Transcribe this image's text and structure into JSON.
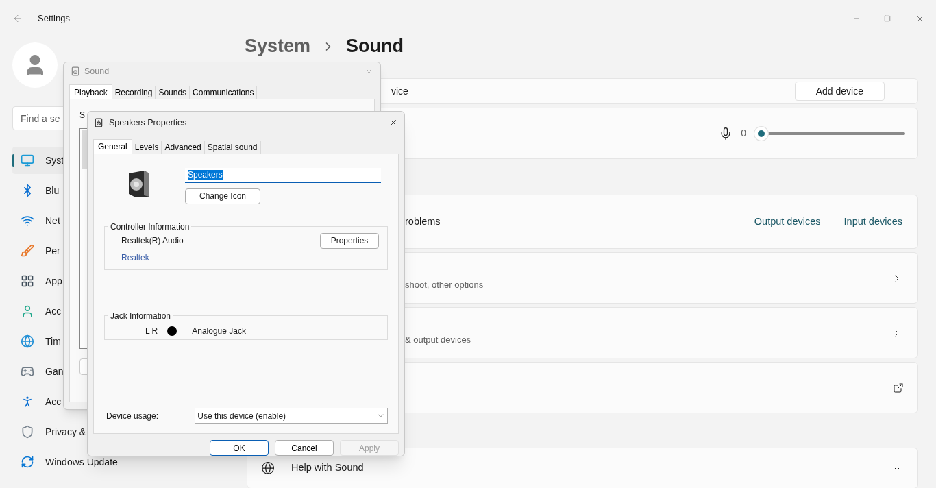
{
  "window": {
    "title": "Settings"
  },
  "search": {
    "placeholder": "Find a se"
  },
  "sidebar": {
    "items": [
      {
        "label": "Syst",
        "selected": true
      },
      {
        "label": "Blu",
        "selected": false
      },
      {
        "label": "Net",
        "selected": false
      },
      {
        "label": "Per",
        "selected": false
      },
      {
        "label": "App",
        "selected": false
      },
      {
        "label": "Acc",
        "selected": false
      },
      {
        "label": "Tim",
        "selected": false
      },
      {
        "label": "Gan",
        "selected": false
      },
      {
        "label": "Acc",
        "selected": false
      },
      {
        "label": "Privacy &",
        "selected": false
      },
      {
        "label": "Windows Update",
        "selected": false
      }
    ]
  },
  "breadcrumb": {
    "parent": "System",
    "current": "Sound"
  },
  "cards": [
    {
      "kind": "button",
      "text": "vice",
      "button": "Add device"
    },
    {
      "kind": "volume",
      "reading": "0",
      "level": 0
    },
    {
      "kind": "links",
      "text": "roblems",
      "links": [
        "Output devices",
        "Input devices"
      ]
    },
    {
      "kind": "nav",
      "subtitle": "shoot, other options"
    },
    {
      "kind": "nav",
      "subtitle": "& output devices"
    },
    {
      "kind": "external"
    }
  ],
  "help": {
    "title": "Help with Sound",
    "expanded": true
  },
  "sound_dialog": {
    "title": "Sound",
    "instruction": "S",
    "tabs": [
      {
        "label": "Playback",
        "selected": true
      },
      {
        "label": "Recording",
        "selected": false
      },
      {
        "label": "Sounds",
        "selected": false
      },
      {
        "label": "Communications",
        "selected": false
      }
    ]
  },
  "speakers_dialog": {
    "title": "Speakers Properties",
    "tabs": [
      {
        "label": "General",
        "selected": true
      },
      {
        "label": "Levels",
        "selected": false
      },
      {
        "label": "Advanced",
        "selected": false
      },
      {
        "label": "Spatial sound",
        "selected": false
      }
    ],
    "name": "Speakers",
    "change_icon": "Change Icon",
    "controller": {
      "heading": "Controller Information",
      "name": "Realtek(R) Audio",
      "button": "Properties",
      "link": "Realtek"
    },
    "jack": {
      "heading": "Jack Information",
      "channels": "L R",
      "color": "#000000",
      "type": "Analogue Jack"
    },
    "device_usage": {
      "label": "Device usage:",
      "value": "Use this device (enable)"
    },
    "buttons": [
      {
        "label": "OK",
        "default": true,
        "disabled": false
      },
      {
        "label": "Cancel",
        "default": false,
        "disabled": false
      },
      {
        "label": "Apply",
        "default": false,
        "disabled": true
      }
    ]
  }
}
